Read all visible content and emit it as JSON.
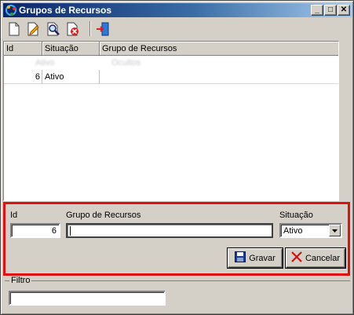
{
  "window": {
    "title": "Grupos de Recursos",
    "controls": [
      "_",
      "□",
      "✕"
    ]
  },
  "toolbar": {
    "icons": [
      "new-document-icon",
      "edit-document-icon",
      "search-icon",
      "delete-icon",
      "exit-door-icon"
    ]
  },
  "grid": {
    "columns": [
      "Id",
      "Situação",
      "Grupo de Recursos"
    ],
    "rows": [
      {
        "id": "",
        "situacao": "Ativo",
        "grupo": "Ocultos"
      },
      {
        "id": "6",
        "situacao": "Ativo",
        "grupo": ""
      }
    ]
  },
  "form": {
    "id_label": "Id",
    "id_value": "6",
    "grupo_label": "Grupo de Recursos",
    "grupo_value": "",
    "situacao_label": "Situação",
    "situacao_value": "Ativo",
    "save_label": "Gravar",
    "cancel_label": "Cancelar"
  },
  "filter": {
    "label": "Filtro",
    "value": ""
  },
  "colors": {
    "highlight_border": "#e01010",
    "title_start": "#0a246a",
    "title_end": "#a6caf0"
  }
}
